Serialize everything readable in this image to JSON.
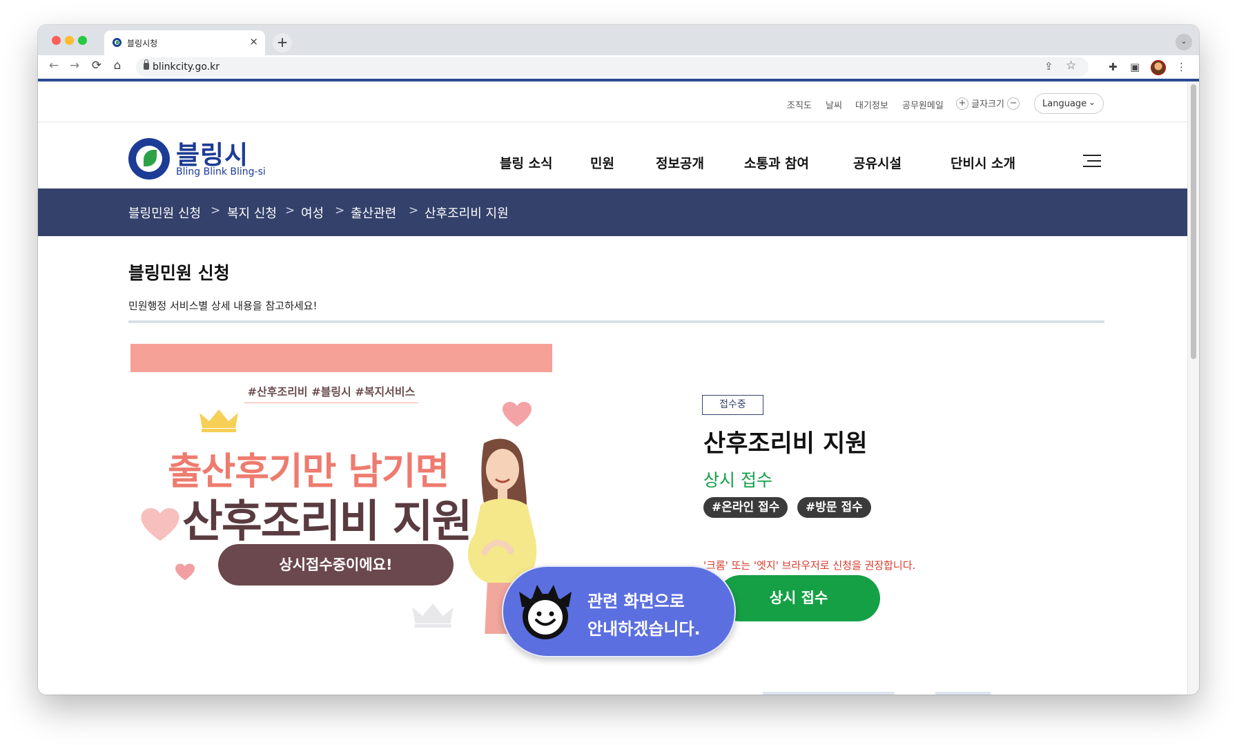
{
  "browser": {
    "tab_title": "블링시청",
    "tab_close": "×",
    "new_tab": "+",
    "tab_menu": "⌄",
    "url": "blinkcity.go.kr",
    "back": "←",
    "forward": "→",
    "reload": "⟳",
    "home": "⌂",
    "share": "⇪",
    "star": "☆",
    "extensions": "✚",
    "sidepanel": "▣",
    "more": "⋮"
  },
  "util_nav": {
    "items": [
      "조직도",
      "날씨",
      "대기정보",
      "공무원메일"
    ],
    "font_plus": "+",
    "font_label": "글자크기",
    "font_minus": "−",
    "language": "Language",
    "language_chevron": "⌄"
  },
  "logo": {
    "ko": "블링시",
    "en": "Bling Blink Bling-si"
  },
  "gnb": [
    "블링 소식",
    "민원",
    "정보공개",
    "소통과 참여",
    "공유시설",
    "단비시 소개"
  ],
  "breadcrumb": {
    "items": [
      "블링민원 신청",
      "복지 신청",
      "여성",
      "출산관련",
      "산후조리비 지원"
    ],
    "separator": ">"
  },
  "section": {
    "title": "블링민원 신청",
    "description": "민원행정 서비스별 상세 내용을 참고하세요!"
  },
  "banner": {
    "hashtags": "#산후조리비 #블링시 #복지서비스",
    "line1": "출산후기만 남기면",
    "line2": "산후조리비 지원",
    "pill": "상시접수중이에요!"
  },
  "service": {
    "badge": "접수중",
    "title": "산후조리비 지원",
    "status": "상시 접수",
    "tags": [
      "#온라인 접수",
      "#방문 접수"
    ],
    "notice": "'크롬' 또는 '엣지' 브라우저로 신청을 권장합니다.",
    "apply_button": "상시 접수"
  },
  "guide": {
    "line1": "관련 화면으로",
    "line2": "안내하겠습니다."
  },
  "colors": {
    "brand_blue": "#1d3c95",
    "brand_green": "#2ca246",
    "crumb_bar": "#34416b",
    "accent_green": "#16a046",
    "guide_blue": "#5b6fe0",
    "banner_pink": "#f5a197"
  }
}
